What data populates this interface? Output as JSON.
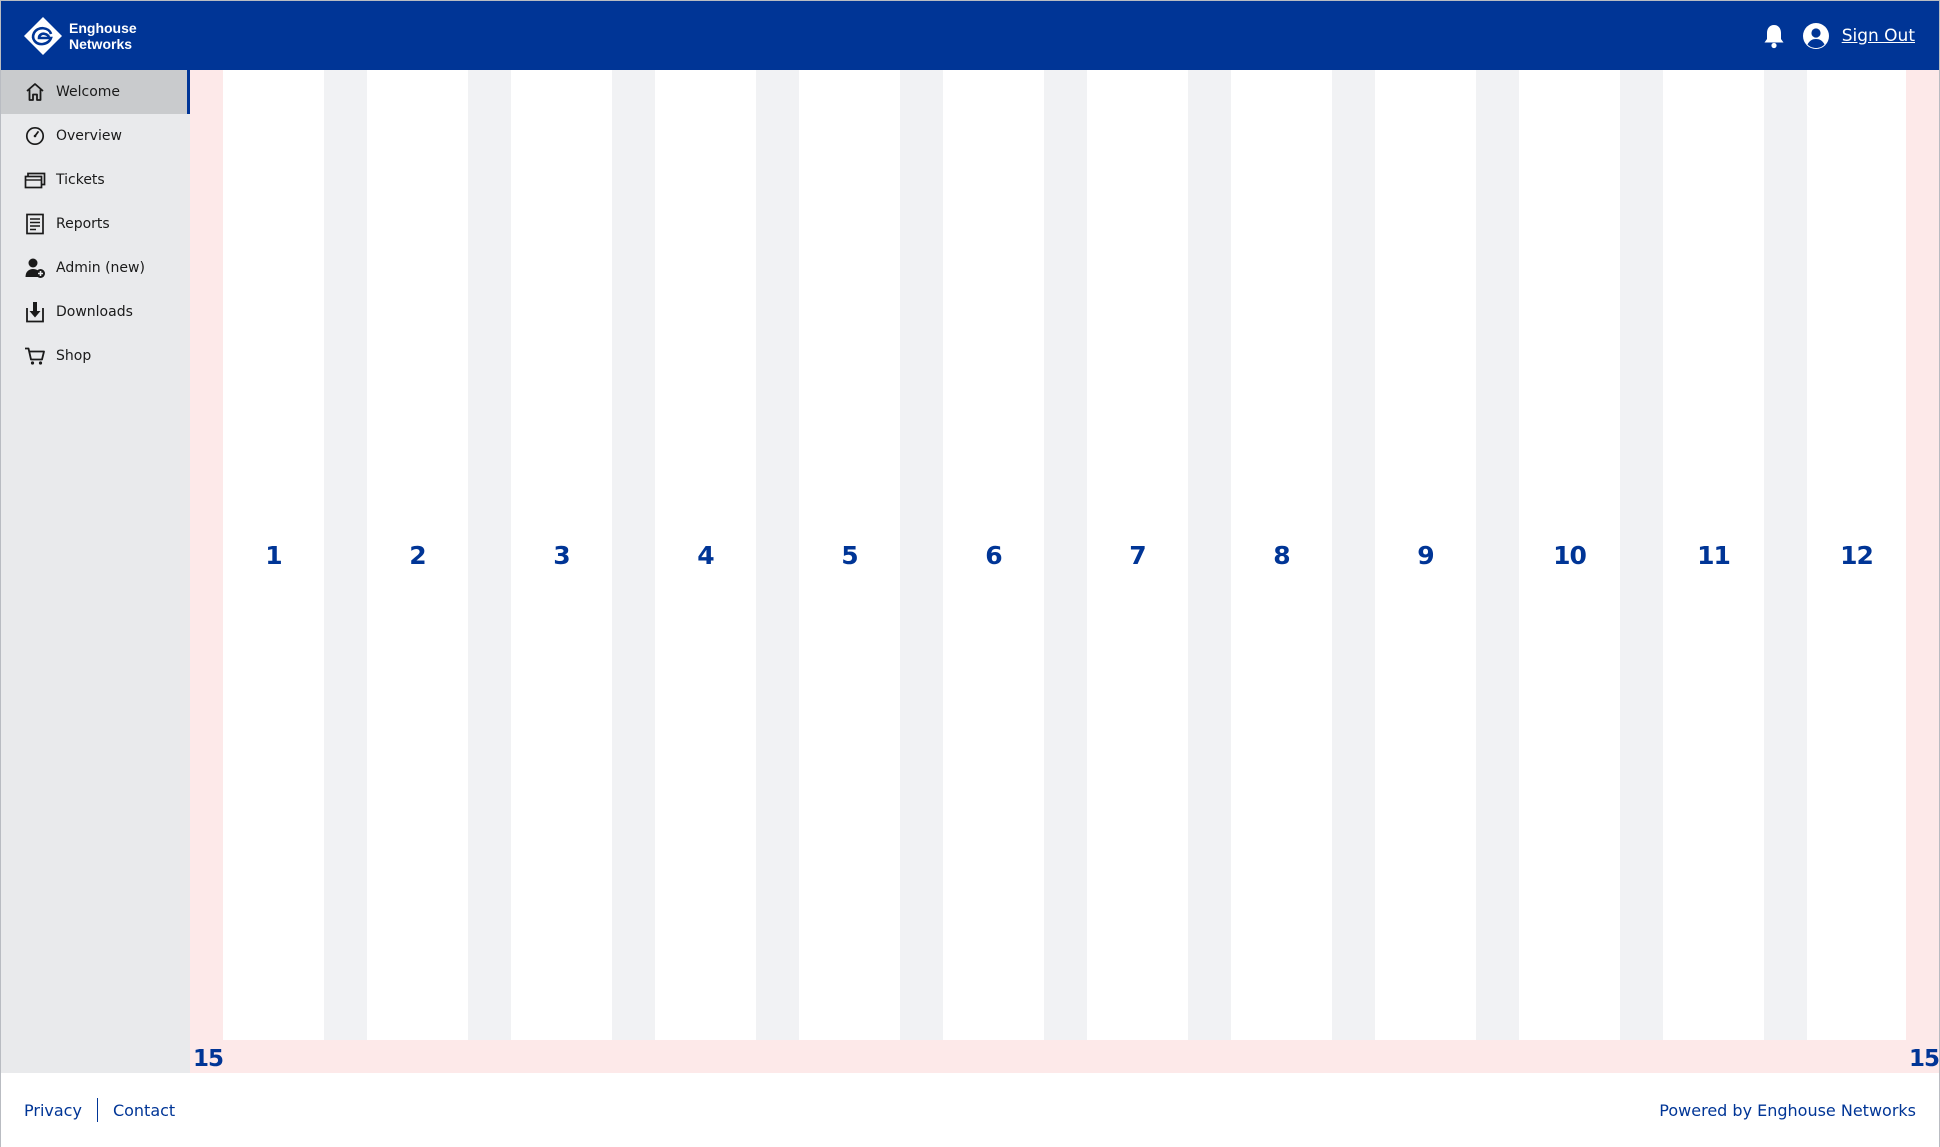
{
  "app": {
    "brand_line1": "Enghouse",
    "brand_line2": "Networks",
    "brand_color": "#003596"
  },
  "header": {
    "notifications_icon": "bell-icon",
    "account_icon": "user-circle-icon",
    "signout_label": "Sign Out"
  },
  "sidebar": {
    "items": [
      {
        "label": "Welcome",
        "icon": "home-icon",
        "active": true
      },
      {
        "label": "Overview",
        "icon": "gauge-icon",
        "active": false
      },
      {
        "label": "Tickets",
        "icon": "tickets-icon",
        "active": false
      },
      {
        "label": "Reports",
        "icon": "report-icon",
        "active": false
      },
      {
        "label": "Admin (new)",
        "icon": "admin-user-icon",
        "active": false
      },
      {
        "label": "Downloads",
        "icon": "download-icon",
        "active": false
      },
      {
        "label": "Shop",
        "icon": "cart-icon",
        "active": false
      }
    ]
  },
  "grid": {
    "columns": [
      "1",
      "2",
      "3",
      "4",
      "5",
      "6",
      "7",
      "8",
      "9",
      "10",
      "11",
      "12"
    ],
    "margin_left": "15",
    "margin_right": "15"
  },
  "footer": {
    "privacy_label": "Privacy",
    "contact_label": "Contact",
    "powered_by": "Powered by Enghouse Networks"
  }
}
